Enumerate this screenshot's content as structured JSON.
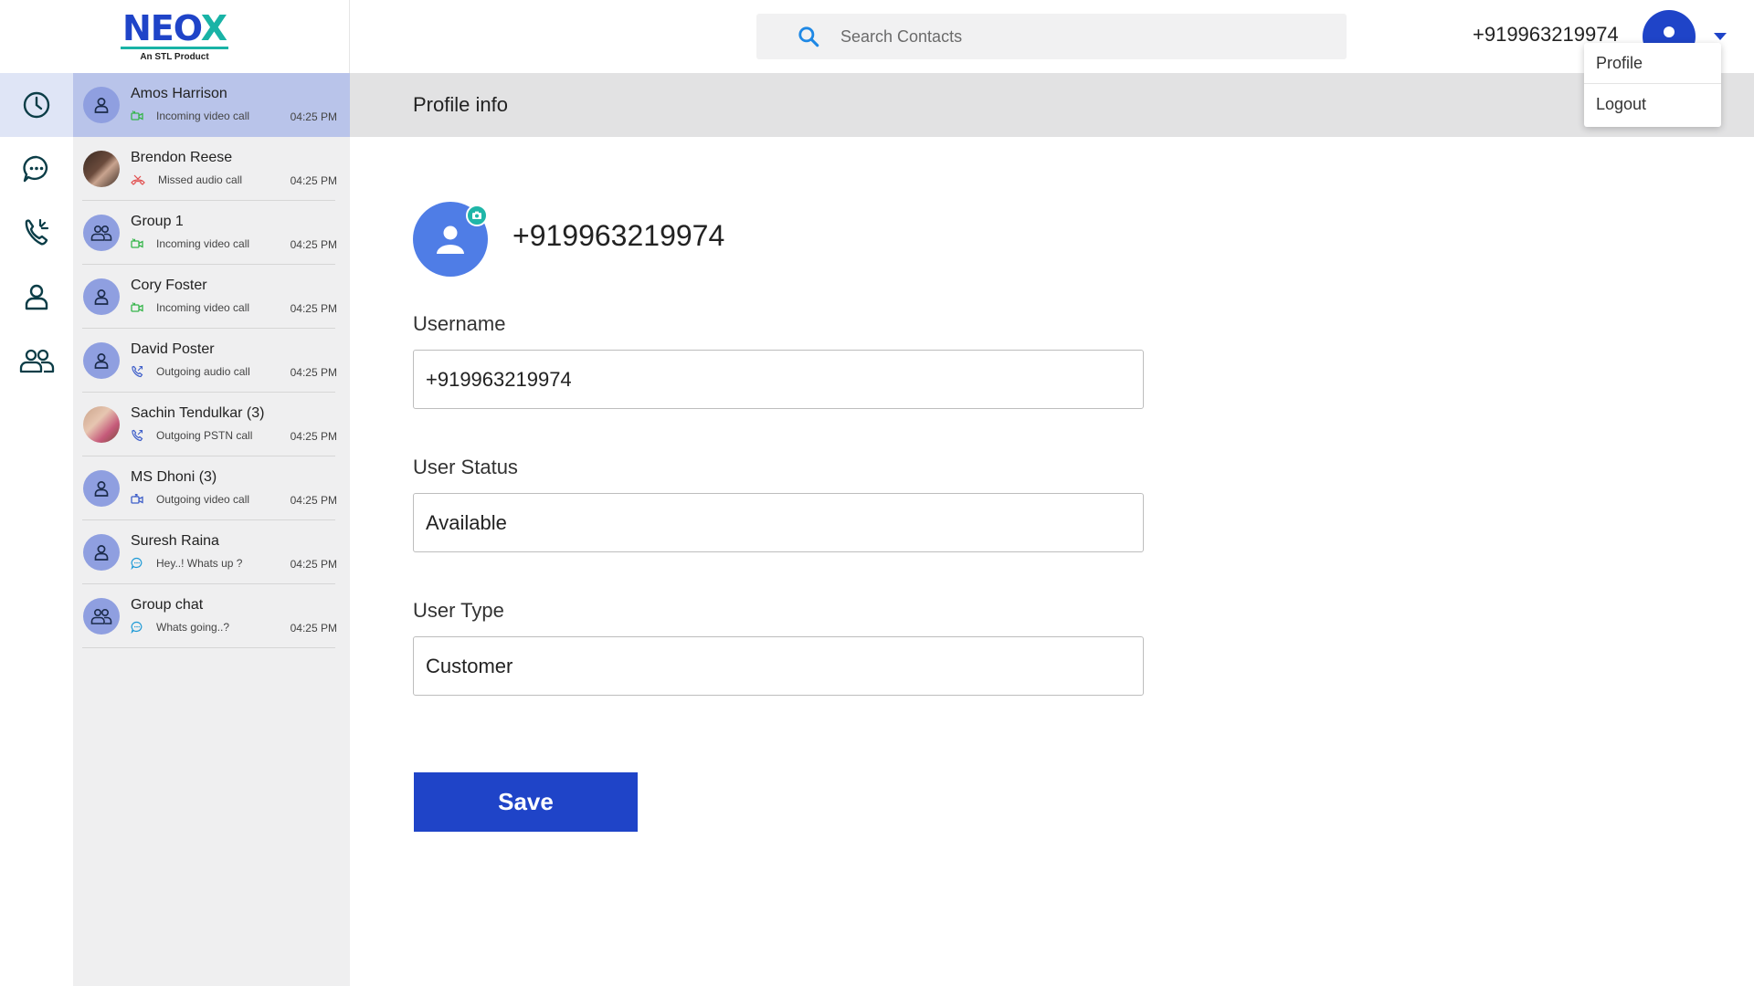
{
  "brand": {
    "logo_text": "NEOX",
    "logo_sub": "An STL Product"
  },
  "search": {
    "placeholder": "Search Contacts"
  },
  "user": {
    "number": "+919963219974"
  },
  "dropdown": {
    "items": [
      {
        "label": "Profile"
      },
      {
        "label": "Logout"
      }
    ]
  },
  "rail": {
    "items": [
      "recent-icon",
      "chat-icon",
      "calls-icon",
      "contact-icon",
      "groups-icon"
    ]
  },
  "contacts": [
    {
      "name": "Amos Harrison",
      "sub": "Incoming video call",
      "time": "04:25 PM",
      "kind": "incoming-video",
      "active": true
    },
    {
      "name": "Brendon Reese",
      "sub": "Missed audio call",
      "time": "04:25 PM",
      "kind": "missed-audio"
    },
    {
      "name": "Group 1",
      "sub": "Incoming video call",
      "time": "04:25 PM",
      "kind": "incoming-video"
    },
    {
      "name": "Cory Foster",
      "sub": "Incoming video call",
      "time": "04:25 PM",
      "kind": "incoming-video"
    },
    {
      "name": "David Poster",
      "sub": "Outgoing audio call",
      "time": "04:25 PM",
      "kind": "outgoing-audio"
    },
    {
      "name": "Sachin Tendulkar (3)",
      "sub": "Outgoing PSTN call",
      "time": "04:25 PM",
      "kind": "outgoing-pstn"
    },
    {
      "name": "MS Dhoni (3)",
      "sub": "Outgoing video call",
      "time": "04:25 PM",
      "kind": "outgoing-video"
    },
    {
      "name": "Suresh Raina",
      "sub": "Hey..! Whats up ?",
      "time": "04:25 PM",
      "kind": "message"
    },
    {
      "name": "Group chat",
      "sub": "Whats going..?",
      "time": "04:25 PM",
      "kind": "message"
    }
  ],
  "colors": {
    "brand_blue": "#1f44c8",
    "accent_teal": "#19b3a6",
    "avatar_blue": "#8f9fe0",
    "active_row": "#b9c4ea"
  },
  "main": {
    "header": "Profile info",
    "profile_number": "+919963219974",
    "fields": [
      {
        "label": "Username",
        "value": "+919963219974"
      },
      {
        "label": "User Status",
        "value": "Available"
      },
      {
        "label": "User Type",
        "value": "Customer"
      }
    ],
    "save_label": "Save"
  }
}
